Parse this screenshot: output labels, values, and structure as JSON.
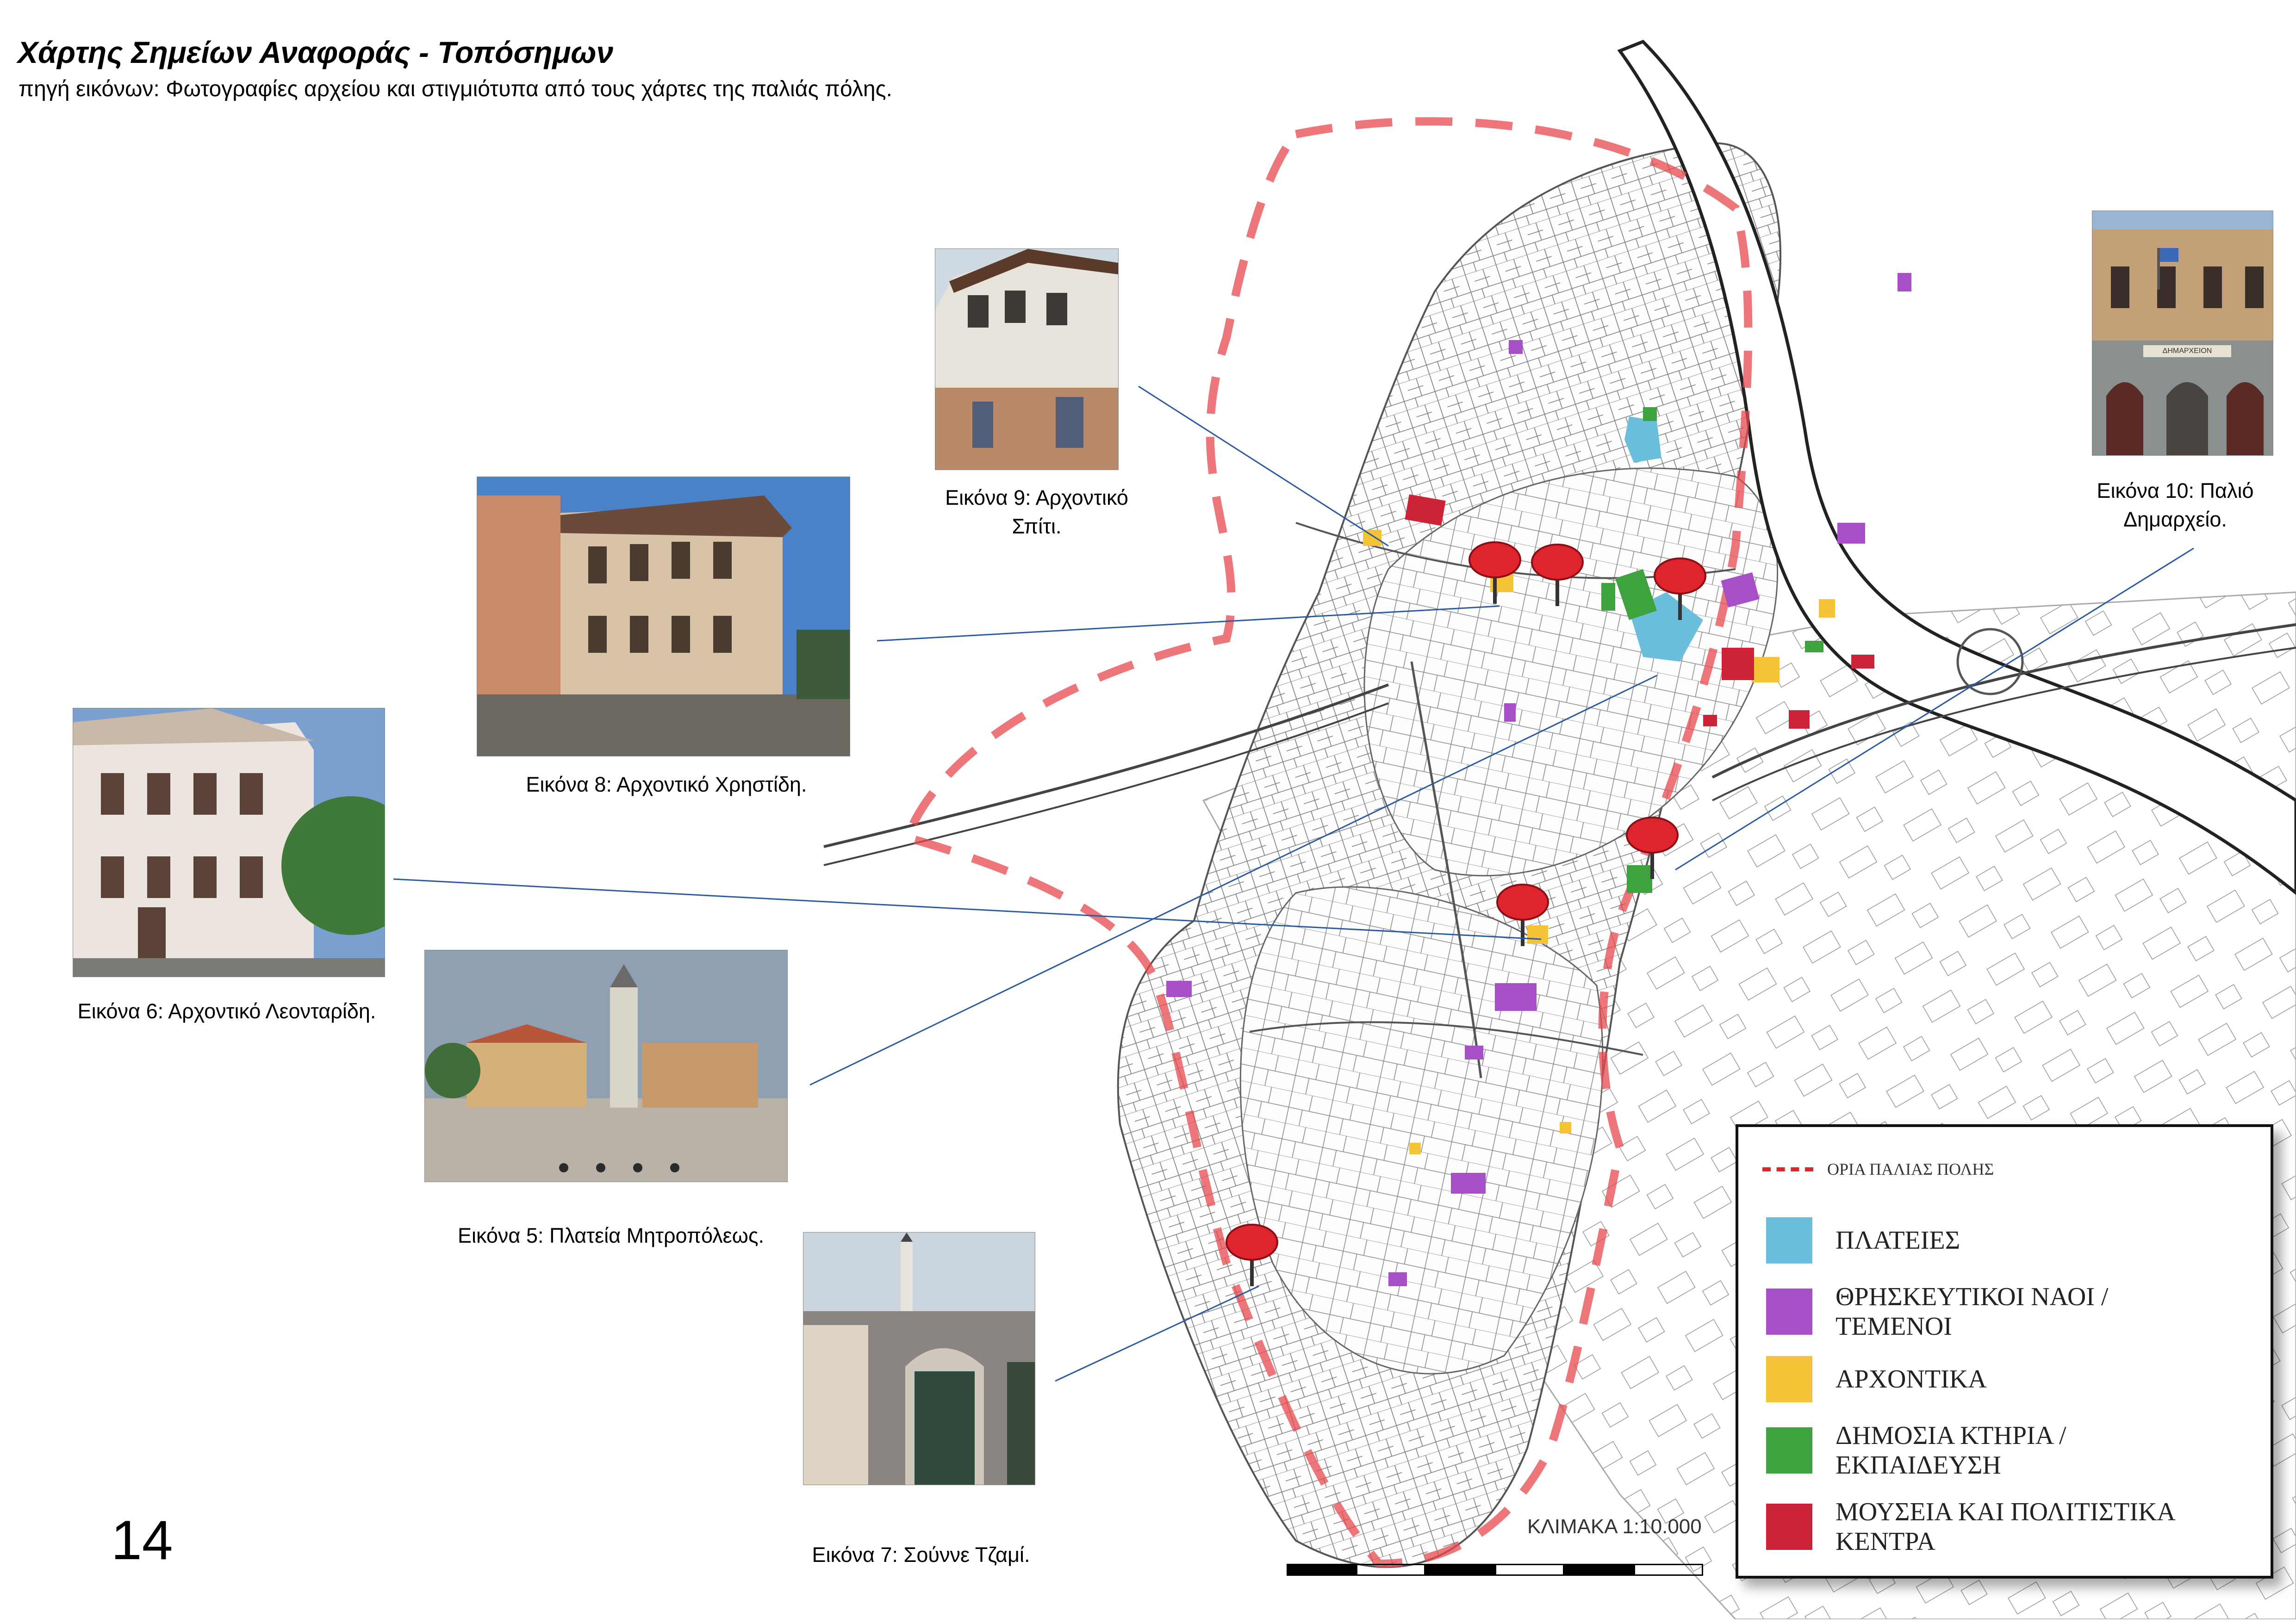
{
  "title": "Χάρτης Σημείων Αναφοράς - Τοπόσημων",
  "subtitle": "πηγή εικόνων: Φωτογραφίες αρχείου και στιγμιότυπα από  τους χάρτες της παλιάς πόλης.",
  "page_number": "14",
  "photos": [
    {
      "id": "9",
      "caption": "Εικόνα 9: Αρχοντικό Σπίτι."
    },
    {
      "id": "8",
      "caption": "Εικόνα 8: Αρχοντικό Χρηστίδη."
    },
    {
      "id": "6",
      "caption": "Εικόνα 6: Αρχοντικό Λεονταρίδη."
    },
    {
      "id": "5",
      "caption": "Εικόνα 5: Πλατεία Μητροπόλεως."
    },
    {
      "id": "7",
      "caption": "Εικόνα 7: Σούννε Τζαμί."
    },
    {
      "id": "10",
      "caption": "Εικόνα 10: Παλιό Δημαρχείο.",
      "sign": "ΔΗΜΑΡΧΕΙΟΝ"
    }
  ],
  "legend": {
    "boundary_label": "ΟΡΙΑ ΠΑΛΙΑΣ ΠΟΛΗΣ",
    "boundary_color": "#d62b2b",
    "items": [
      {
        "label": "ΠΛΑΤΕΙΕΣ",
        "color": "#6bbfdd"
      },
      {
        "label": "ΘΡΗΣΚΕΥΤΙΚΟΙ ΝΑΟΙ / ΤΕΜΕΝΟΙ",
        "color": "#a64fc6"
      },
      {
        "label": "ΑΡΧΟΝΤΙΚΑ",
        "color": "#f5c338"
      },
      {
        "label": "ΔΗΜΟΣΙΑ ΚΤΗΡΙΑ / ΕΚΠΑΙΔΕΥΣΗ",
        "color": "#3ea23e"
      },
      {
        "label": "ΜΟΥΣΕΙΑ ΚΑΙ ΠΟΛΙΤΙΣΤΙΚΑ ΚΕΝΤΡΑ",
        "color": "#cc2436"
      }
    ]
  },
  "scale_label": "ΚΛΙΜΑΚΑ 1:10.000",
  "marker_icon": "map-pin-icon",
  "marker_color": "#e0242e"
}
